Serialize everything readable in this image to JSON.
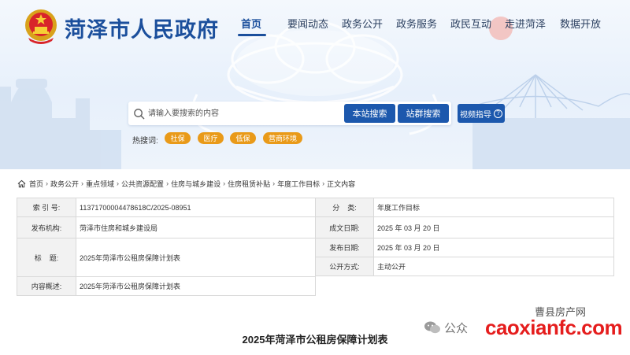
{
  "header": {
    "site_title": "菏泽市人民政府",
    "nav": [
      {
        "label": "首页",
        "active": true
      },
      {
        "label": "要闻动态"
      },
      {
        "label": "政务公开"
      },
      {
        "label": "政务服务"
      },
      {
        "label": "政民互动"
      },
      {
        "label": "走进菏泽"
      },
      {
        "label": "数据开放"
      }
    ]
  },
  "search": {
    "placeholder": "请输入要搜索的内容",
    "site_search_label": "本站搜索",
    "group_search_label": "站群搜索",
    "video_guide_label": "视频指导",
    "hot_label": "热搜词:",
    "hot_words": [
      "社保",
      "医疗",
      "低保",
      "营商环境"
    ]
  },
  "breadcrumb": [
    "首页",
    "政务公开",
    "重点领域",
    "公共资源配置",
    "住房与城乡建设",
    "住房租赁补贴",
    "年度工作目标",
    "正文内容"
  ],
  "info_table": {
    "left": [
      {
        "label": "索 引 号:",
        "value": "11371700004478618C/2025-08951"
      },
      {
        "label": "发布机构:",
        "value": "菏泽市住房和城乡建设局"
      },
      {
        "label": "标    题:",
        "value": "2025年菏泽市公租房保障计划表"
      },
      {
        "label": "内容概述:",
        "value": "2025年菏泽市公租房保障计划表"
      }
    ],
    "right": [
      {
        "label": "分    类:",
        "value": "年度工作目标"
      },
      {
        "label": "成文日期:",
        "value": "2025 年 03 月 20 日"
      },
      {
        "label": "发布日期:",
        "value": "2025 年 03 月 20 日"
      },
      {
        "label": "公开方式:",
        "value": "主动公开"
      }
    ]
  },
  "article": {
    "title": "2025年菏泽市公租房保障计划表"
  },
  "watermark": {
    "line1": "曹县房产网",
    "public_label": "公众",
    "brand": "caoxianfc.com"
  },
  "colors": {
    "primary_blue": "#1c58ad",
    "hot_tag_orange": "#e99a19",
    "watermark_red": "#e51d1d"
  }
}
